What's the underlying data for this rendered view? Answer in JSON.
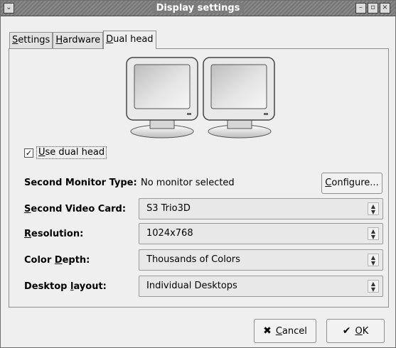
{
  "window": {
    "title": "Display settings",
    "menu_glyph": "⌄",
    "min_glyph": "–",
    "max_glyph": "▫",
    "close_glyph": "×"
  },
  "tabs": [
    {
      "label_u": "S",
      "label_rest": "ettings"
    },
    {
      "label_u": "H",
      "label_rest": "ardware"
    },
    {
      "label_u": "D",
      "label_rest": "ual head"
    }
  ],
  "dual_head": {
    "checkbox_mark": "✓",
    "checkbox_label_u": "U",
    "checkbox_label_rest": "se dual head",
    "second_monitor": {
      "label": "Second Monitor Type:",
      "value": "No monitor selected",
      "button_u": "C",
      "button_rest": "onfigure..."
    },
    "video_card": {
      "label_u": "S",
      "label_rest": "econd Video Card:",
      "value": "S3 Trio3D"
    },
    "resolution": {
      "label_u": "R",
      "label_rest": "esolution:",
      "value": "1024x768"
    },
    "color_depth": {
      "label_pre": "Color ",
      "label_u": "D",
      "label_rest": "epth:",
      "value": "Thousands of Colors"
    },
    "desktop_layout": {
      "label_pre": "Desktop ",
      "label_u": "l",
      "label_rest": "ayout:",
      "value": "Individual Desktops"
    },
    "combo_arrow": "▲▼"
  },
  "buttons": {
    "cancel_icon": "✖",
    "cancel_u": "C",
    "cancel_rest": "ancel",
    "ok_icon": "✔",
    "ok_u": "O",
    "ok_rest": "K"
  }
}
